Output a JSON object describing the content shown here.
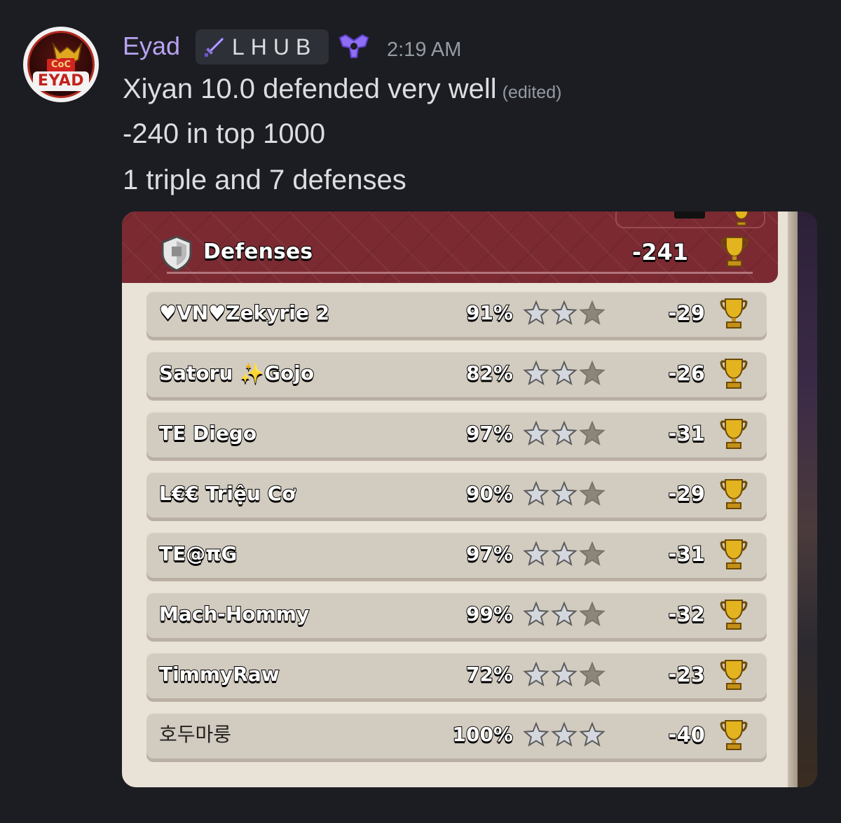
{
  "message": {
    "avatar_text": "EYAD",
    "avatar_badge_text": "CoC",
    "username": "Eyad",
    "server_tag": "LHUB",
    "timestamp": "2:19 AM",
    "lines": [
      "Xiyan 10.0 defended very well",
      "-240 in top 1000",
      "1 triple and 7 defenses"
    ],
    "edited_label": "(edited)",
    "colors": {
      "username": "#b8a2f2",
      "text": "#dbdee1",
      "muted": "#949ba4",
      "background": "#1c1d22"
    }
  },
  "game": {
    "section_title": "Defenses",
    "total_trophies": "-241",
    "colors": {
      "header": "#7b2a31",
      "panel": "#e9e2d6",
      "row": "#d2cbbf",
      "star_filled": "#c9cdd3",
      "star_empty": "#8c857b",
      "trophy": "#e3b320"
    },
    "defenses": [
      {
        "name": "♥VN♥Zekyrie 2",
        "percent": "91%",
        "stars": 2,
        "trophies": "-29"
      },
      {
        "name": "Satoru ✨Gojo",
        "percent": "82%",
        "stars": 2,
        "trophies": "-26"
      },
      {
        "name": "TE Diego",
        "percent": "97%",
        "stars": 2,
        "trophies": "-31"
      },
      {
        "name": "L€€ Triệu Cơ",
        "percent": "90%",
        "stars": 2,
        "trophies": "-29"
      },
      {
        "name": "TE@πG",
        "percent": "97%",
        "stars": 2,
        "trophies": "-31"
      },
      {
        "name": "Mach-Hommy",
        "percent": "99%",
        "stars": 2,
        "trophies": "-32"
      },
      {
        "name": "TimmyRaw",
        "percent": "72%",
        "stars": 2,
        "trophies": "-23"
      },
      {
        "name": "호두마룽",
        "percent": "100%",
        "stars": 3,
        "trophies": "-40"
      }
    ]
  }
}
